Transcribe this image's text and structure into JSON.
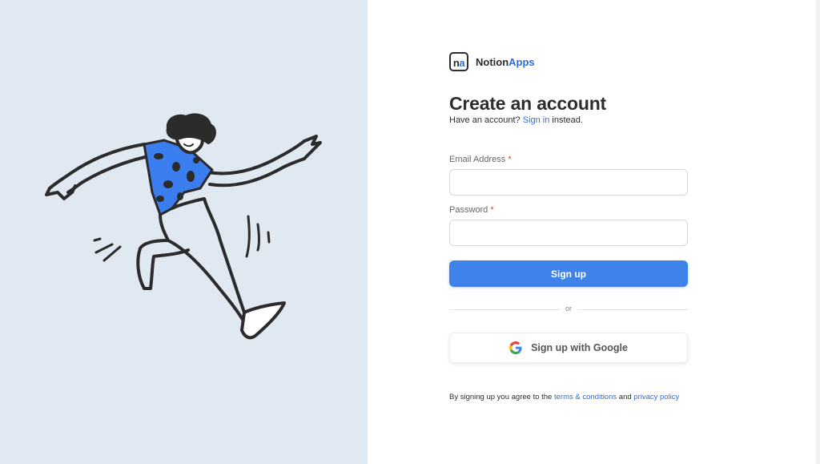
{
  "brand": {
    "logo_text_n": "n",
    "logo_text_a": "a",
    "name_primary": "Notion",
    "name_accent": "Apps"
  },
  "title": "Create an account",
  "subtitle": {
    "prefix": "Have an account? ",
    "link": "Sign in",
    "suffix": " instead."
  },
  "form": {
    "email_label": "Email Address",
    "email_value": "",
    "email_placeholder": "",
    "password_label": "Password",
    "password_value": "",
    "password_placeholder": "",
    "required_mark": "*",
    "submit_label": "Sign up"
  },
  "divider_text": "or",
  "google_button": {
    "label": "Sign up with Google",
    "icon": "google-icon"
  },
  "terms": {
    "prefix": "By signing up you agree to the ",
    "terms_link": "terms & conditions",
    "middle": " and ",
    "privacy_link": "privacy policy"
  },
  "colors": {
    "accent": "#3f83ea",
    "link": "#2d6cdf",
    "left_panel_bg": "#e0e8f2",
    "illustration_shirt": "#3b7ef0",
    "text": "#2d2d2d",
    "required": "#e03c3c"
  }
}
